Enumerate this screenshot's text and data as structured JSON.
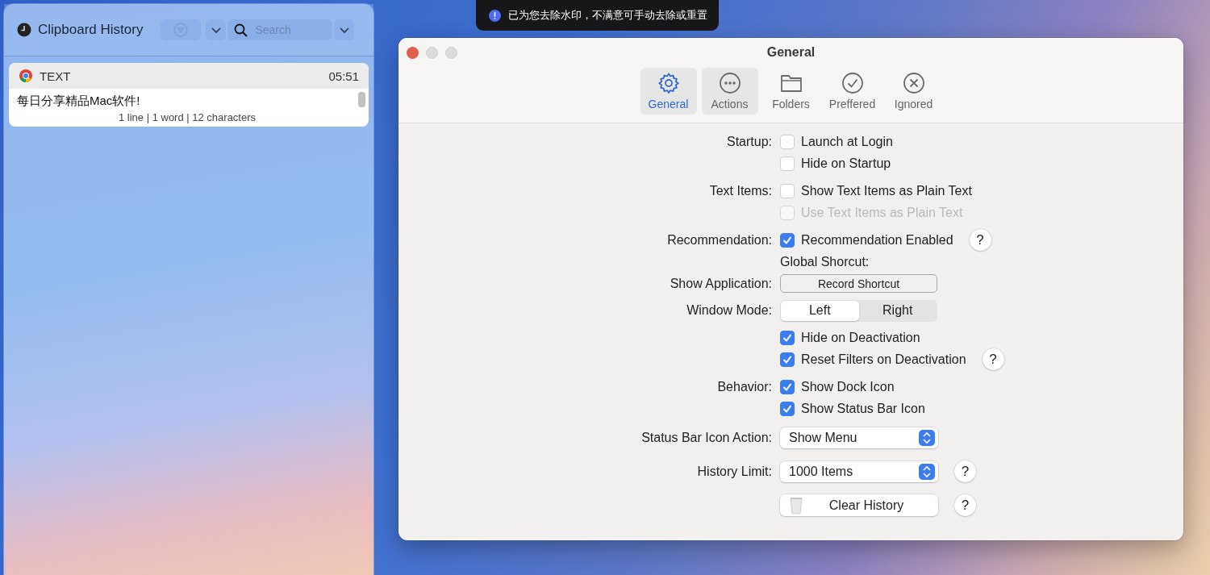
{
  "toast": {
    "text": "已为您去除水印，不满意可手动去除或重置"
  },
  "clipboard_panel": {
    "title": "Clipboard History",
    "search": {
      "placeholder": "Search"
    },
    "items": [
      {
        "type": "TEXT",
        "time": "05:51",
        "content": "每日分享精品Mac软件!",
        "info": "1 line | 1 word | 12 characters"
      }
    ]
  },
  "settings_window": {
    "title": "General",
    "tabs": [
      {
        "label": "General",
        "selected": true,
        "hovered": false
      },
      {
        "label": "Actions",
        "selected": false,
        "hovered": true
      },
      {
        "label": "Folders",
        "selected": false,
        "hovered": false
      },
      {
        "label": "Preffered",
        "selected": false,
        "hovered": false
      },
      {
        "label": "Ignored",
        "selected": false,
        "hovered": false
      }
    ],
    "rows": [
      {
        "kind": "checkbox",
        "label": "Startup:",
        "text": "Launch at Login",
        "checked": false,
        "disabled": false
      },
      {
        "kind": "checkbox",
        "text": "Hide on Startup",
        "checked": false,
        "disabled": false
      },
      {
        "kind": "checkbox",
        "label": "Text Items:",
        "text": "Show Text Items as Plain Text",
        "checked": false,
        "disabled": false
      },
      {
        "kind": "checkbox",
        "text": "Use Text Items as Plain Text",
        "checked": false,
        "disabled": true
      },
      {
        "kind": "checkbox",
        "label": "Recommendation:",
        "text": "Recommendation Enabled",
        "checked": true,
        "disabled": false,
        "help": "?"
      },
      {
        "kind": "note",
        "text": "Global Shorcut:"
      },
      {
        "kind": "button",
        "label": "Show Application:",
        "text": "Record Shortcut"
      },
      {
        "kind": "segmented",
        "label": "Window Mode:",
        "options": [
          {
            "label": "Left",
            "selected": true
          },
          {
            "label": "Right",
            "selected": false
          }
        ]
      },
      {
        "kind": "checkbox",
        "text": "Hide on Deactivation",
        "checked": true,
        "disabled": false
      },
      {
        "kind": "checkbox",
        "text": "Reset Filters on Deactivation",
        "checked": true,
        "disabled": false,
        "help": "?"
      },
      {
        "kind": "checkbox",
        "label": "Behavior:",
        "text": "Show Dock Icon",
        "checked": true,
        "disabled": false
      },
      {
        "kind": "checkbox",
        "text": "Show Status Bar Icon",
        "checked": true,
        "disabled": false
      },
      {
        "kind": "select",
        "label": "Status Bar Icon Action:",
        "value": "Show Menu"
      },
      {
        "kind": "select",
        "label": "History Limit:",
        "value": "1000 Items",
        "help": "?"
      },
      {
        "kind": "action",
        "text": "Clear History",
        "help": "?"
      }
    ]
  }
}
